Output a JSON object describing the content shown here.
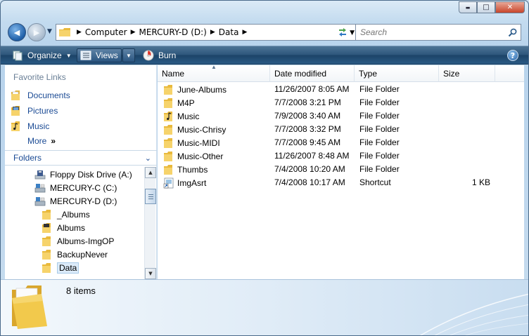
{
  "window": {
    "minimize_glyph": "▬",
    "maximize_glyph": "□",
    "close_glyph": "✕"
  },
  "navigation": {
    "back_glyph": "◀",
    "forward_glyph": "▶",
    "history_glyph": "▼",
    "breadcrumb": [
      "Computer",
      "MERCURY-D (D:)",
      "Data"
    ],
    "refresh_glyph": "↻",
    "search_placeholder": "Search"
  },
  "toolbar": {
    "organize_label": "Organize",
    "views_label": "Views",
    "burn_label": "Burn",
    "help_glyph": "?"
  },
  "favorite_links": {
    "heading": "Favorite Links",
    "items": [
      {
        "label": "Documents",
        "icon": "documents-folder-icon"
      },
      {
        "label": "Pictures",
        "icon": "pictures-folder-icon"
      },
      {
        "label": "Music",
        "icon": "music-folder-icon"
      }
    ],
    "more_label": "More",
    "more_glyph": "»"
  },
  "folders": {
    "heading": "Folders",
    "tree": [
      {
        "label": "Floppy Disk Drive (A:)",
        "icon": "floppy-drive-icon"
      },
      {
        "label": "MERCURY-C (C:)",
        "icon": "hard-drive-icon"
      },
      {
        "label": "MERCURY-D (D:)",
        "icon": "hard-drive-icon"
      },
      {
        "label": "_Albums",
        "icon": "folder-icon"
      },
      {
        "label": "Albums",
        "icon": "music-folder-icon"
      },
      {
        "label": "Albums-ImgOP",
        "icon": "folder-icon"
      },
      {
        "label": "BackupNever",
        "icon": "folder-icon"
      },
      {
        "label": "Data",
        "icon": "folder-icon",
        "selected": true
      }
    ]
  },
  "file_list": {
    "columns": [
      "Name",
      "Date modified",
      "Type",
      "Size"
    ],
    "rows": [
      {
        "name": "June-Albums",
        "date": "11/26/2007 8:05 AM",
        "type": "File Folder",
        "size": "",
        "icon": "folder-icon"
      },
      {
        "name": "M4P",
        "date": "7/7/2008 3:21 PM",
        "type": "File Folder",
        "size": "",
        "icon": "folder-icon"
      },
      {
        "name": "Music",
        "date": "7/9/2008 3:40 AM",
        "type": "File Folder",
        "size": "",
        "icon": "music-folder-icon"
      },
      {
        "name": "Music-Chrisy",
        "date": "7/7/2008 3:32 PM",
        "type": "File Folder",
        "size": "",
        "icon": "folder-icon"
      },
      {
        "name": "Music-MIDI",
        "date": "7/7/2008 9:45 AM",
        "type": "File Folder",
        "size": "",
        "icon": "folder-icon"
      },
      {
        "name": "Music-Other",
        "date": "11/26/2007 8:48 AM",
        "type": "File Folder",
        "size": "",
        "icon": "folder-icon"
      },
      {
        "name": "Thumbs",
        "date": "7/4/2008 10:20 AM",
        "type": "File Folder",
        "size": "",
        "icon": "folder-icon"
      },
      {
        "name": "ImgAsrt",
        "date": "7/4/2008 10:17 AM",
        "type": "Shortcut",
        "size": "1 KB",
        "icon": "shortcut-icon"
      }
    ]
  },
  "details_pane": {
    "item_count": "8 items"
  },
  "colors": {
    "link_blue": "#1a4a94",
    "folder_yellow": "#f2c94c",
    "command_bar": "#2c557b",
    "selection": "#dcebf9"
  }
}
